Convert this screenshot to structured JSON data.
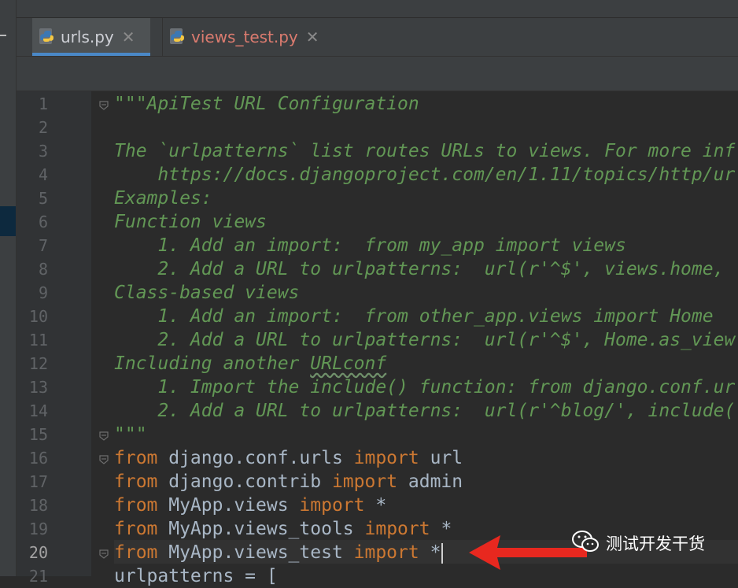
{
  "tabs": [
    {
      "label": "urls.py",
      "active": true,
      "icon": "python-file-icon"
    },
    {
      "label": "views_test.py",
      "active": false,
      "icon": "python-file-icon"
    }
  ],
  "tab_close_glyph": "✕",
  "line_numbers": [
    "1",
    "2",
    "3",
    "4",
    "5",
    "6",
    "7",
    "8",
    "9",
    "10",
    "11",
    "12",
    "13",
    "14",
    "15",
    "16",
    "17",
    "18",
    "19",
    "20",
    "21"
  ],
  "current_line": "20",
  "docstring": [
    "\"\"\"ApiTest URL Configuration",
    "",
    "The `urlpatterns` list routes URLs to views. For more inf",
    "    https://docs.djangoproject.com/en/1.11/topics/http/ur",
    "Examples:",
    "Function views",
    "    1. Add an import:  from my_app import views",
    "    2. Add a URL to urlpatterns:  url(r'^$', views.home,",
    "Class-based views",
    "    1. Add an import:  from other_app.views import Home",
    "    2. Add a URL to urlpatterns:  url(r'^$', Home.as_view",
    "Including another ",
    "    1. Import the include() function: from django.conf.ur",
    "    2. Add a URL to urlpatterns:  url(r'^blog/', include(",
    "\"\"\""
  ],
  "docstring_squiggle_word": "URLconf",
  "imports": [
    {
      "kw1": "from",
      "mod": " django.conf.urls ",
      "kw2": "import",
      "name": " url"
    },
    {
      "kw1": "from",
      "mod": " django.contrib ",
      "kw2": "import",
      "name": " admin"
    },
    {
      "kw1": "from",
      "mod": " MyApp.views ",
      "kw2": "import",
      "name": " *"
    },
    {
      "kw1": "from",
      "mod": " MyApp.views_tools ",
      "kw2": "import",
      "name": " *"
    },
    {
      "kw1": "from",
      "mod": " MyApp.views_test ",
      "kw2": "import",
      "name": " *"
    }
  ],
  "line21": "urlpatterns = [",
  "watermark": "测试开发干货",
  "colors": {
    "keyword": "#cc7832",
    "docstring": "#629755",
    "text": "#a9b7c6",
    "arrow": "#e8281f",
    "accent": "#4a88c7"
  }
}
